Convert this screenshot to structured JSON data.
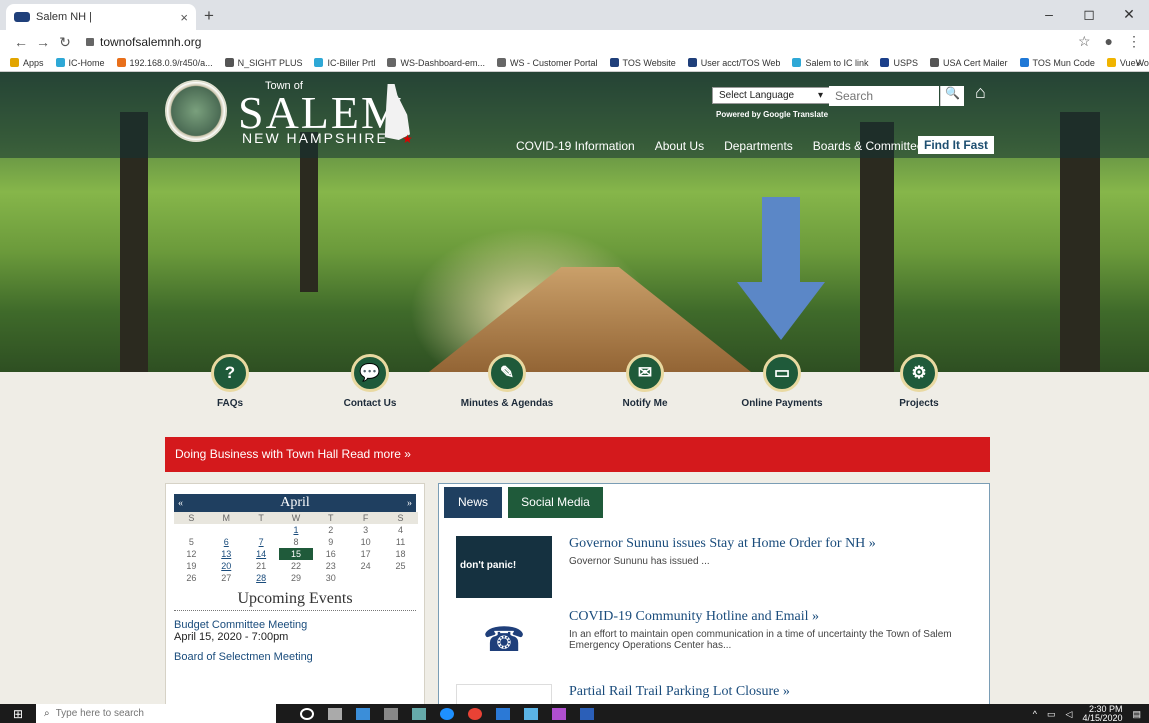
{
  "browser": {
    "tab_title": "Salem NH |",
    "tab_close": "×",
    "new_tab": "+",
    "url": "townofsalemnh.org",
    "window_controls": [
      "–",
      "◻",
      "✕"
    ],
    "bookmarks": [
      {
        "label": "Apps",
        "color": "#e2a500"
      },
      {
        "label": "IC-Home",
        "color": "#2ea8d6"
      },
      {
        "label": "192.168.0.9/r450/a...",
        "color": "#e86f1b"
      },
      {
        "label": "N_SIGHT PLUS",
        "color": "#555555"
      },
      {
        "label": "IC-Biller Prtl",
        "color": "#2ea8d6"
      },
      {
        "label": "WS-Dashboard-em...",
        "color": "#666666"
      },
      {
        "label": "WS - Customer Portal",
        "color": "#666666"
      },
      {
        "label": "TOS Website",
        "color": "#1f3f7a"
      },
      {
        "label": "User acct/TOS Web",
        "color": "#1f3f7a"
      },
      {
        "label": "Salem to IC link",
        "color": "#2ea8d6"
      },
      {
        "label": "USPS",
        "color": "#1b3f8a"
      },
      {
        "label": "USA Cert Mailer",
        "color": "#555555"
      },
      {
        "label": "TOS Mun Code",
        "color": "#1f78d6"
      },
      {
        "label": "VueWorks",
        "color": "#f0b400"
      }
    ],
    "bookmarks_more": "»"
  },
  "site": {
    "town_of": "Town of",
    "name": "SALEM",
    "state": "NEW HAMPSHIRE",
    "language_select": "Select Language",
    "powered_by": "Powered by Google Translate",
    "search_placeholder": "Search",
    "nav": [
      "COVID-19 Information",
      "About Us",
      "Departments",
      "Boards & Committees"
    ],
    "find_it_fast": "Find It Fast",
    "quick_links": [
      {
        "label": "FAQs",
        "icon": "question-icon",
        "glyph": "?"
      },
      {
        "label": "Contact Us",
        "icon": "chat-icon",
        "glyph": "💬"
      },
      {
        "label": "Minutes & Agendas",
        "icon": "edit-icon",
        "glyph": "✎"
      },
      {
        "label": "Notify Me",
        "icon": "envelope-icon",
        "glyph": "✉"
      },
      {
        "label": "Online Payments",
        "icon": "laptop-icon",
        "glyph": "▭"
      },
      {
        "label": "Projects",
        "icon": "gears-icon",
        "glyph": "⚙"
      }
    ],
    "banner": "Doing Business with Town Hall Read more »"
  },
  "calendar": {
    "month": "April",
    "prev": "«",
    "next": "»",
    "weekdays": [
      "S",
      "M",
      "T",
      "W",
      "T",
      "F",
      "S"
    ],
    "weeks": [
      [
        "",
        "",
        "",
        "1",
        "2",
        "3",
        "4"
      ],
      [
        "5",
        "6",
        "7",
        "8",
        "9",
        "10",
        "11"
      ],
      [
        "12",
        "13",
        "14",
        "15",
        "16",
        "17",
        "18"
      ],
      [
        "19",
        "20",
        "21",
        "22",
        "23",
        "24",
        "25"
      ],
      [
        "26",
        "27",
        "28",
        "29",
        "30",
        "",
        ""
      ]
    ],
    "linked_days": [
      "1",
      "6",
      "7",
      "13",
      "14",
      "20",
      "28"
    ],
    "today": "15",
    "upcoming_title": "Upcoming Events",
    "events": [
      {
        "title": "Budget Committee Meeting",
        "date": "April 15, 2020 - 7:00pm"
      },
      {
        "title": "Board of Selectmen Meeting",
        "date": ""
      }
    ]
  },
  "news": {
    "tabs": [
      "News",
      "Social Media"
    ],
    "items": [
      {
        "title": "Governor Sununu issues Stay at Home Order for NH »",
        "desc": "Governor Sununu has issued ...",
        "thumb_text": "don't panic!"
      },
      {
        "title": "COVID-19 Community Hotline and Email »",
        "desc": "In an effort to maintain open communication in a time of uncertainty the Town of Salem Emergency Operations Center has..."
      },
      {
        "title": "Partial Rail Trail Parking Lot Closure »",
        "desc": ""
      }
    ]
  },
  "taskbar": {
    "search_placeholder": "Type here to search",
    "time": "2:30 PM",
    "date": "4/15/2020"
  }
}
